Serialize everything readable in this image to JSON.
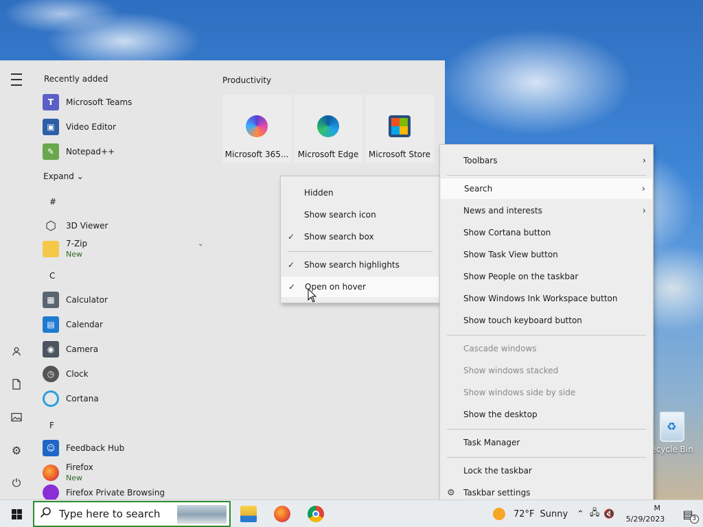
{
  "start_menu": {
    "recently_added_title": "Recently added",
    "recent": [
      {
        "name": "Microsoft Teams",
        "icon": "teams-icon",
        "color": "#5b5fc7"
      },
      {
        "name": "Video Editor",
        "icon": "video-editor-icon",
        "color": "#2b5fa8"
      },
      {
        "name": "Notepad++",
        "icon": "notepadpp-icon",
        "color": "#6aa84f"
      }
    ],
    "expand_label": "Expand",
    "apps": {
      "hash_letter": "#",
      "item_3d_viewer": "3D Viewer",
      "item_7zip": "7-Zip",
      "item_7zip_new": "New",
      "c_letter": "C",
      "item_calculator": "Calculator",
      "item_calendar": "Calendar",
      "item_camera": "Camera",
      "item_clock": "Clock",
      "item_cortana": "Cortana",
      "f_letter": "F",
      "item_feedback_hub": "Feedback Hub",
      "item_firefox": "Firefox",
      "item_firefox_new": "New",
      "item_firefox_private": "Firefox Private Browsing"
    },
    "tiles_group": "Productivity",
    "tiles": [
      {
        "label": "Microsoft 365...",
        "icon": "microsoft-365-icon"
      },
      {
        "label": "Microsoft Edge",
        "icon": "edge-icon"
      },
      {
        "label": "Microsoft Store",
        "icon": "store-icon"
      }
    ]
  },
  "search_submenu": {
    "items": [
      {
        "label": "Hidden",
        "checked": false
      },
      {
        "label": "Show search icon",
        "checked": false
      },
      {
        "label": "Show search box",
        "checked": true
      },
      {
        "label": "Show search highlights",
        "checked": true
      },
      {
        "label": "Open on hover",
        "checked": true
      }
    ],
    "check_glyph": "✓"
  },
  "taskbar_menu": {
    "toolbars": "Toolbars",
    "search": "Search",
    "news": "News and interests",
    "cortana": "Show Cortana button",
    "task_view": "Show Task View button",
    "people": "Show People on the taskbar",
    "ink": "Show Windows Ink Workspace button",
    "touch_kb": "Show touch keyboard button",
    "cascade": "Cascade windows",
    "stacked": "Show windows stacked",
    "side_by_side": "Show windows side by side",
    "show_desktop": "Show the desktop",
    "task_manager": "Task Manager",
    "lock": "Lock the taskbar",
    "settings": "Taskbar settings",
    "arrow_glyph": "›"
  },
  "desktop": {
    "recycle_bin_label": "ecycle Bin"
  },
  "taskbar": {
    "search_placeholder": "Type here to search",
    "weather_temp": "72°F",
    "weather_cond": "Sunny",
    "clock_time": "M",
    "clock_date": "5/29/2023",
    "notification_count": "3"
  }
}
